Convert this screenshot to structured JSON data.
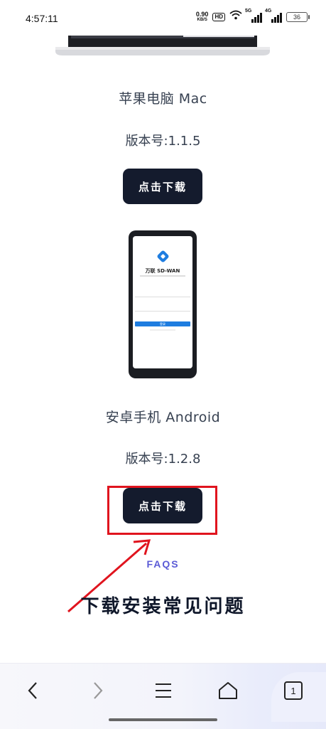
{
  "status_bar": {
    "time": "4:57:11",
    "net_speed_value": "0.90",
    "net_speed_unit": "KB/S",
    "hd_badge": "HD",
    "signal1_label": "5G",
    "signal2_label": "4G",
    "battery": "36"
  },
  "mac": {
    "title": "苹果电脑 Mac",
    "version": "版本号:1.1.5",
    "download_label": "点击下载"
  },
  "android": {
    "title": "安卓手机 Android",
    "version": "版本号:1.2.8",
    "download_label": "点击下载",
    "screenshot": {
      "app_name": "万联 SD-WAN",
      "login_button": "登录"
    }
  },
  "faqs": {
    "label": "FAQS",
    "heading": "下载安装常见问题"
  },
  "browser_nav": {
    "tab_count": "1"
  },
  "colors": {
    "button_bg": "#141b2d",
    "accent": "#5b5bd6",
    "annotation_red": "#e0141e"
  }
}
